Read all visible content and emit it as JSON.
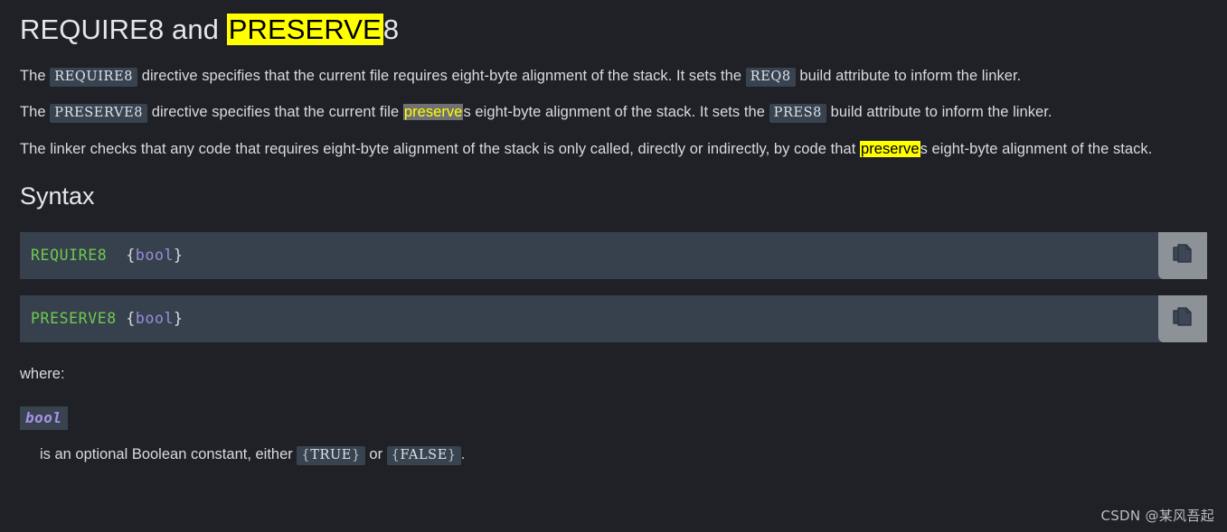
{
  "page": {
    "background_color": "#1f2127",
    "text_color": "#d7dbe0"
  },
  "title": {
    "before_highlight": "REQUIRE8 and ",
    "highlighted": "PRESERVE",
    "after_highlight": "8"
  },
  "paragraphs": {
    "p1": {
      "s1": "The ",
      "code1": "REQUIRE8",
      "s2": " directive specifies that the current file requires eight-byte alignment of the stack. It sets the ",
      "code2": "REQ8",
      "s3": " build attribute to inform the linker."
    },
    "p2": {
      "s1": "The ",
      "code1": "PRESERVE8",
      "s2": " directive specifies that the current file ",
      "hl": "preserve",
      "s3": "s eight-byte alignment of the stack. It sets the ",
      "code2": "PRES8",
      "s4": " build attribute to inform the linker."
    },
    "p3": {
      "s1": "The linker checks that any code that requires eight-byte alignment of the stack is only called, directly or indirectly, by code that ",
      "hl": "preserve",
      "s2": "s eight-byte alignment of the stack."
    }
  },
  "syntax": {
    "heading": "Syntax",
    "blocks": [
      {
        "keyword": "REQUIRE8",
        "space": "  ",
        "open_brace": "{",
        "variable": "bool",
        "close_brace": "}",
        "copy_label": "copy-icon"
      },
      {
        "keyword": "PRESERVE8",
        "space": " ",
        "open_brace": "{",
        "variable": "bool",
        "close_brace": "}",
        "copy_label": "copy-icon"
      }
    ]
  },
  "where": {
    "label": "where:",
    "term": "bool",
    "definition": {
      "s1": "is an optional Boolean constant, either ",
      "code1_open": "{",
      "code1_text": "TRUE",
      "code1_close": "}",
      "s2": " or ",
      "code2_open": "{",
      "code2_text": "FALSE",
      "code2_close": "}",
      "s3": "."
    }
  },
  "watermark": "CSDN @某风吾起",
  "colors": {
    "highlight_yellow": "#ffff00",
    "highlight_gray": "#6f7175",
    "code_block_bg": "#37414d",
    "inline_code_bg": "#39434f",
    "keyword_green": "#6fca4e",
    "variable_purple": "#9b8ddb",
    "copy_button_bg": "#8d9299"
  }
}
